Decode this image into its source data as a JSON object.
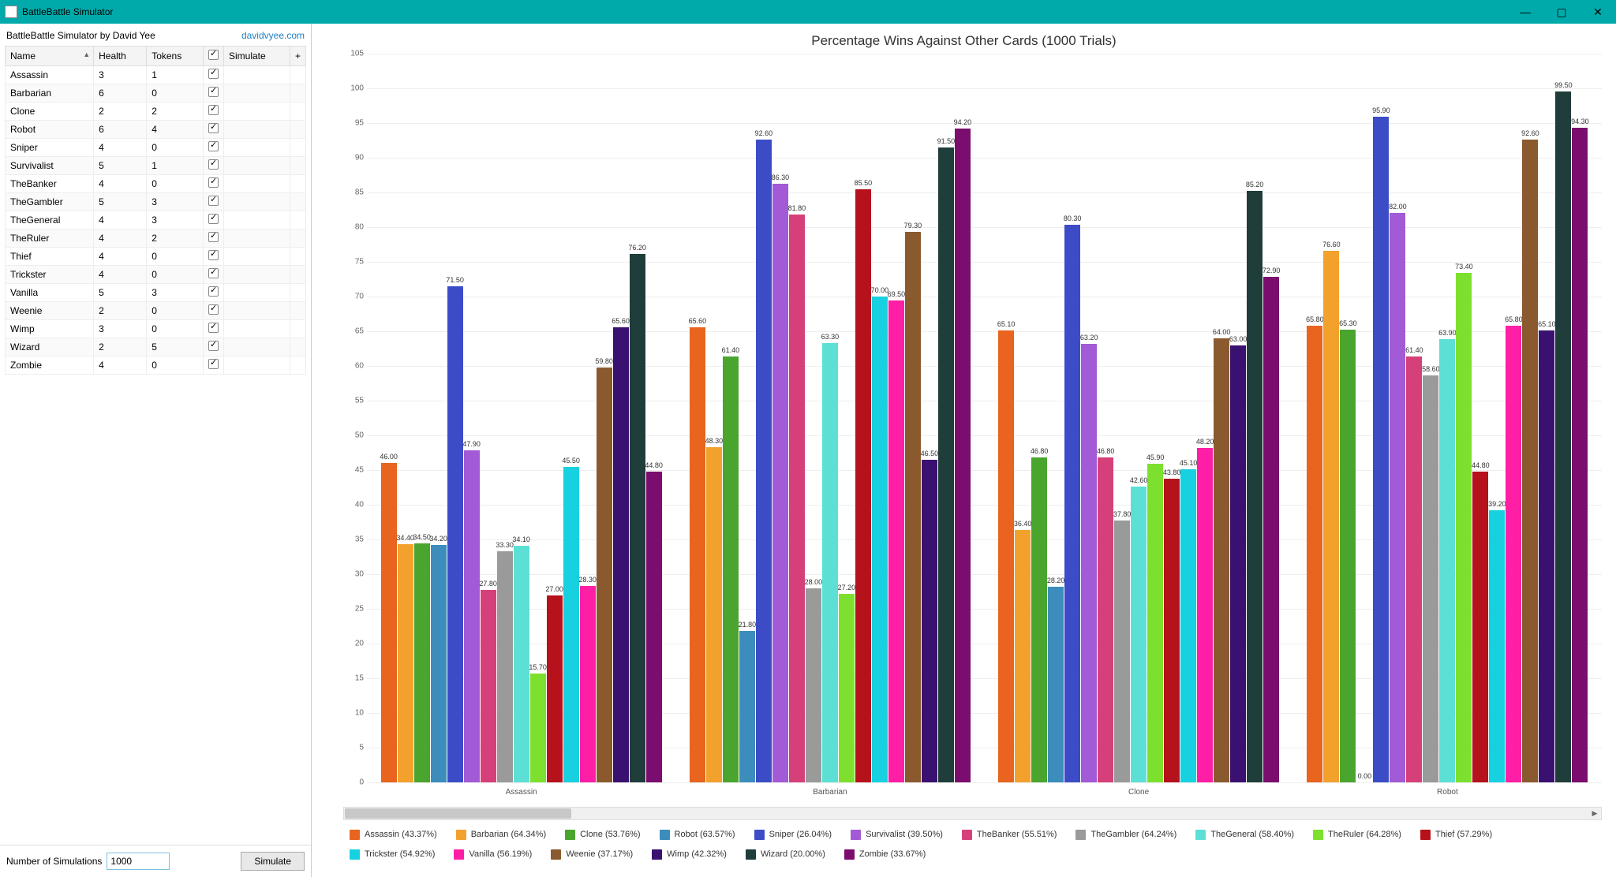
{
  "window": {
    "title": "BattleBattle Simulator"
  },
  "header": {
    "credit": "BattleBattle Simulator by David Yee",
    "link": "davidvyee.com"
  },
  "columns": {
    "name": "Name",
    "health": "Health",
    "tokens": "Tokens",
    "simulate": "Simulate"
  },
  "cards": [
    {
      "name": "Assassin",
      "health": 3,
      "tokens": 1
    },
    {
      "name": "Barbarian",
      "health": 6,
      "tokens": 0
    },
    {
      "name": "Clone",
      "health": 2,
      "tokens": 2
    },
    {
      "name": "Robot",
      "health": 6,
      "tokens": 4
    },
    {
      "name": "Sniper",
      "health": 4,
      "tokens": 0
    },
    {
      "name": "Survivalist",
      "health": 5,
      "tokens": 1
    },
    {
      "name": "TheBanker",
      "health": 4,
      "tokens": 0
    },
    {
      "name": "TheGambler",
      "health": 5,
      "tokens": 3
    },
    {
      "name": "TheGeneral",
      "health": 4,
      "tokens": 3
    },
    {
      "name": "TheRuler",
      "health": 4,
      "tokens": 2
    },
    {
      "name": "Thief",
      "health": 4,
      "tokens": 0
    },
    {
      "name": "Trickster",
      "health": 4,
      "tokens": 0
    },
    {
      "name": "Vanilla",
      "health": 5,
      "tokens": 3
    },
    {
      "name": "Weenie",
      "health": 2,
      "tokens": 0
    },
    {
      "name": "Wimp",
      "health": 3,
      "tokens": 0
    },
    {
      "name": "Wizard",
      "health": 2,
      "tokens": 5
    },
    {
      "name": "Zombie",
      "health": 4,
      "tokens": 0
    }
  ],
  "sim": {
    "label": "Number of Simulations",
    "value": "1000",
    "button": "Simulate"
  },
  "series_colors": {
    "Assassin": "#e8641f",
    "Barbarian": "#f2a22c",
    "Clone": "#4aa52e",
    "Robot": "#3c8dbc",
    "Sniper": "#3c4cc7",
    "Survivalist": "#a35ad6",
    "TheBanker": "#d6407a",
    "TheGambler": "#9a9a9a",
    "TheGeneral": "#5ce0d6",
    "TheRuler": "#7ee02e",
    "Thief": "#b5121b",
    "Trickster": "#17d0e0",
    "Vanilla": "#ff1ea6",
    "Weenie": "#8a5a2e",
    "Wimp": "#3a1170",
    "Wizard": "#1f3d3a",
    "Zombie": "#7a0d6e"
  },
  "legend_pct": {
    "Assassin": 43.37,
    "Barbarian": 64.34,
    "Clone": 53.76,
    "Robot": 63.57,
    "Sniper": 26.04,
    "Survivalist": 39.5,
    "TheBanker": 55.51,
    "TheGambler": 64.24,
    "TheGeneral": 58.4,
    "TheRuler": 64.28,
    "Thief": 57.29,
    "Trickster": 54.92,
    "Vanilla": 56.19,
    "Weenie": 37.17,
    "Wimp": 42.32,
    "Wizard": 20.0,
    "Zombie": 33.67
  },
  "chart_data": {
    "type": "bar",
    "title": "Percentage Wins Against Other Cards (1000 Trials)",
    "ylabel": "",
    "xlabel": "",
    "ylim": [
      0,
      105
    ],
    "yticks": [
      0,
      5,
      10,
      15,
      20,
      25,
      30,
      35,
      40,
      45,
      50,
      55,
      60,
      65,
      70,
      75,
      80,
      85,
      90,
      95,
      100,
      105
    ],
    "categories": [
      "Assassin",
      "Barbarian",
      "Clone",
      "Robot"
    ],
    "series_order": [
      "Assassin",
      "Barbarian",
      "Clone",
      "Robot",
      "Sniper",
      "Survivalist",
      "TheBanker",
      "TheGambler",
      "TheGeneral",
      "TheRuler",
      "Thief",
      "Trickster",
      "Vanilla",
      "Weenie",
      "Wimp",
      "Wizard",
      "Zombie"
    ],
    "data": {
      "Assassin": {
        "Assassin": 46.0,
        "Barbarian": 34.4,
        "Clone": 34.5,
        "Robot": 34.2,
        "Sniper": 71.5,
        "Survivalist": 47.9,
        "TheBanker": 27.8,
        "TheGambler": 33.3,
        "TheGeneral": 34.1,
        "TheRuler": 15.7,
        "Thief": 27.0,
        "Trickster": 45.5,
        "Vanilla": 28.3,
        "Weenie": 59.8,
        "Wimp": 65.6,
        "Wizard": 76.2,
        "Zombie": 44.8
      },
      "Barbarian": {
        "Assassin": 65.6,
        "Barbarian": 48.3,
        "Clone": 61.4,
        "Robot": 21.8,
        "Sniper": 92.6,
        "Survivalist": 86.3,
        "TheBanker": 81.8,
        "TheGambler": 28.0,
        "TheGeneral": 63.3,
        "TheRuler": 27.2,
        "Thief": 85.5,
        "Trickster": 70.0,
        "Vanilla": 69.5,
        "Weenie": 79.3,
        "Wimp": 46.5,
        "Wizard": 91.5,
        "Zombie": 94.2
      },
      "Clone": {
        "Assassin": 65.1,
        "Barbarian": 36.4,
        "Clone": 46.8,
        "Robot": 28.2,
        "Sniper": 80.3,
        "Survivalist": 63.2,
        "TheBanker": 46.8,
        "TheGambler": 37.8,
        "TheGeneral": 42.6,
        "TheRuler": 45.9,
        "Thief": 43.8,
        "Trickster": 45.1,
        "Vanilla": 48.2,
        "Weenie": 64.0,
        "Wimp": 63.0,
        "Wizard": 85.2,
        "Zombie": 72.9
      },
      "Robot": {
        "Assassin": 65.8,
        "Barbarian": 76.6,
        "Clone": 65.3,
        "Robot": 0.0,
        "Sniper": 95.9,
        "Survivalist": 82.0,
        "TheBanker": 61.4,
        "TheGambler": 58.6,
        "TheGeneral": 63.9,
        "TheRuler": 73.4,
        "Thief": 44.8,
        "Trickster": 39.2,
        "Vanilla": 65.8,
        "Weenie": 92.6,
        "Wimp": 65.1,
        "Wizard": 99.5,
        "Zombie": 94.3
      }
    }
  }
}
